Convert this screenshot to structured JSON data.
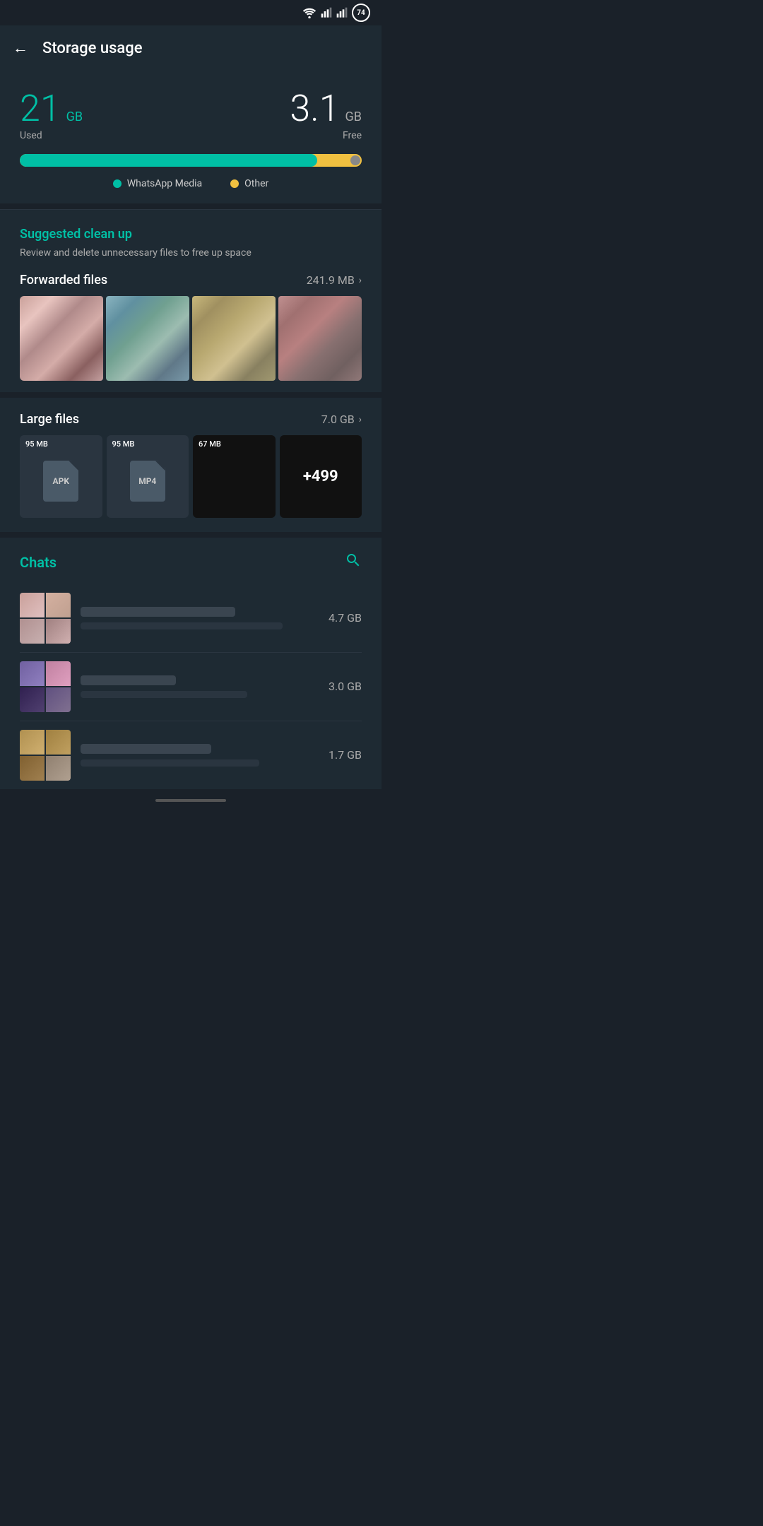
{
  "statusBar": {
    "batteryLevel": "74"
  },
  "appBar": {
    "title": "Storage usage",
    "backLabel": "←"
  },
  "storageSummary": {
    "usedAmount": "21",
    "usedUnit": "GB",
    "usedLabel": "Used",
    "freeAmount": "3.1",
    "freeUnit": "GB",
    "freeLabel": "Free",
    "whatsappMediaLabel": "WhatsApp Media",
    "otherLabel": "Other",
    "progressFillPercent": 87
  },
  "suggestedCleanup": {
    "title": "Suggested clean up",
    "subtitle": "Review and delete unnecessary files to free up space"
  },
  "forwardedFiles": {
    "title": "Forwarded files",
    "size": "241.9 MB",
    "chevron": "›"
  },
  "largeFiles": {
    "title": "Large files",
    "size": "7.0 GB",
    "chevron": "›",
    "files": [
      {
        "size": "95 MB",
        "type": "APK",
        "dark": false
      },
      {
        "size": "95 MB",
        "type": "MP4",
        "dark": false
      },
      {
        "size": "67 MB",
        "type": "",
        "dark": true
      },
      {
        "size": "",
        "type": "+499",
        "dark": true
      }
    ]
  },
  "chats": {
    "title": "Chats",
    "searchIcon": "🔍",
    "items": [
      {
        "size": "4.7 GB"
      },
      {
        "size": "3.0 GB"
      },
      {
        "size": "1.7 GB"
      }
    ]
  },
  "bottomNav": {}
}
